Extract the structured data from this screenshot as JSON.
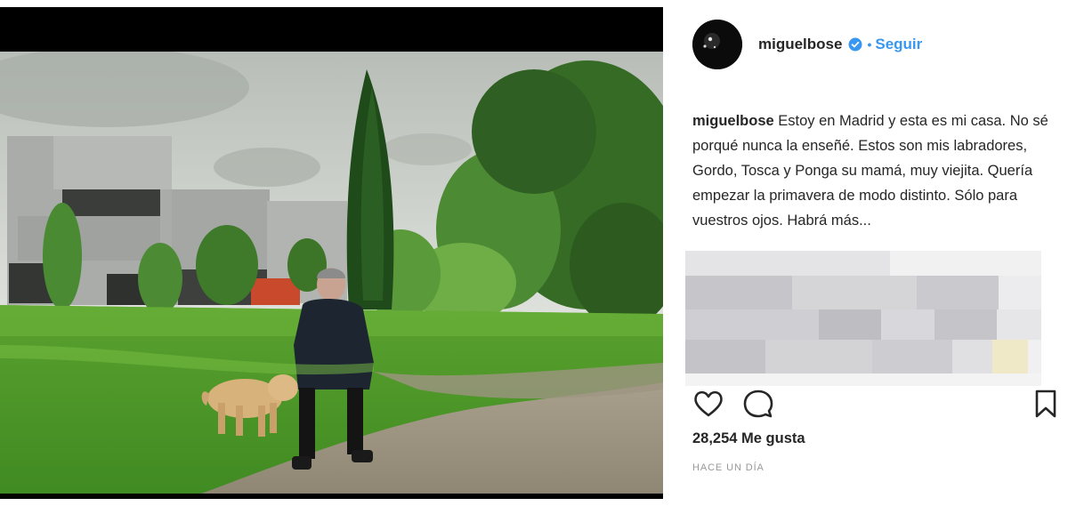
{
  "post": {
    "username": "miguelbose",
    "follow_label": "Seguir",
    "separator": "•",
    "caption_user": "miguelbose",
    "caption_text": " Estoy en Madrid y esta es mi casa. No sé porqué nunca la enseñé. Estos son mis labradores, Gordo, Tosca y Ponga su mamá, muy viejita. Quería empezar la primavera de modo distinto. Sólo para vuestros ojos. Habrá más...",
    "likes": "28,254 Me gusta",
    "timestamp": "HACE UN DÍA"
  },
  "icons": {
    "verified": "verified-badge-icon",
    "like": "heart-icon",
    "comment": "comment-bubble-icon",
    "save": "bookmark-icon"
  },
  "colors": {
    "accent": "#3897f0",
    "text": "#262626",
    "muted": "#999999"
  }
}
